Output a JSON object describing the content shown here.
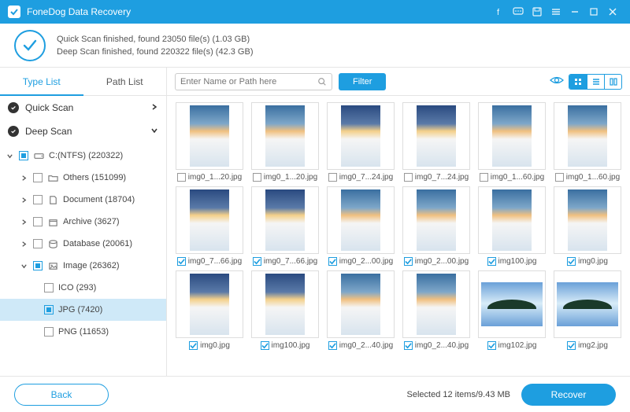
{
  "app": {
    "title": "FoneDog Data Recovery"
  },
  "status": {
    "line1": "Quick Scan finished, found 23050 file(s) (1.03 GB)",
    "line2": "Deep Scan finished, found 220322 file(s) (42.3 GB)"
  },
  "tabs": {
    "type_list": "Type List",
    "path_list": "Path List"
  },
  "scan": {
    "quick": "Quick Scan",
    "deep": "Deep Scan"
  },
  "tree": {
    "drive": "C:(NTFS) (220322)",
    "others": "Others (151099)",
    "document": "Document (18704)",
    "archive": "Archive (3627)",
    "database": "Database (20061)",
    "image": "Image (26362)",
    "ico": "ICO (293)",
    "jpg": "JPG (7420)",
    "png": "PNG (11653)"
  },
  "toolbar": {
    "search_placeholder": "Enter Name or Path here",
    "filter": "Filter"
  },
  "grid": [
    {
      "name": "img0_1...20.jpg",
      "checked": false,
      "variant": "sky1"
    },
    {
      "name": "img0_1...20.jpg",
      "checked": false,
      "variant": "sky1"
    },
    {
      "name": "img0_7...24.jpg",
      "checked": false,
      "variant": "sky2"
    },
    {
      "name": "img0_7...24.jpg",
      "checked": false,
      "variant": "sky2"
    },
    {
      "name": "img0_1...60.jpg",
      "checked": false,
      "variant": "sky1"
    },
    {
      "name": "img0_1...60.jpg",
      "checked": false,
      "variant": "sky1"
    },
    {
      "name": "img0_7...66.jpg",
      "checked": true,
      "variant": "sky2"
    },
    {
      "name": "img0_7...66.jpg",
      "checked": true,
      "variant": "sky2"
    },
    {
      "name": "img0_2...00.jpg",
      "checked": true,
      "variant": "sky1"
    },
    {
      "name": "img0_2...00.jpg",
      "checked": true,
      "variant": "sky1"
    },
    {
      "name": "img100.jpg",
      "checked": true,
      "variant": "sky1"
    },
    {
      "name": "img0.jpg",
      "checked": true,
      "variant": "sky1"
    },
    {
      "name": "img0.jpg",
      "checked": true,
      "variant": "sky2"
    },
    {
      "name": "img100.jpg",
      "checked": true,
      "variant": "sky2"
    },
    {
      "name": "img0_2...40.jpg",
      "checked": true,
      "variant": "sky1"
    },
    {
      "name": "img0_2...40.jpg",
      "checked": true,
      "variant": "sky1"
    },
    {
      "name": "img102.jpg",
      "checked": true,
      "variant": "lake"
    },
    {
      "name": "img2.jpg",
      "checked": true,
      "variant": "lake"
    }
  ],
  "footer": {
    "back": "Back",
    "selected": "Selected 12 items/9.43 MB",
    "recover": "Recover"
  }
}
